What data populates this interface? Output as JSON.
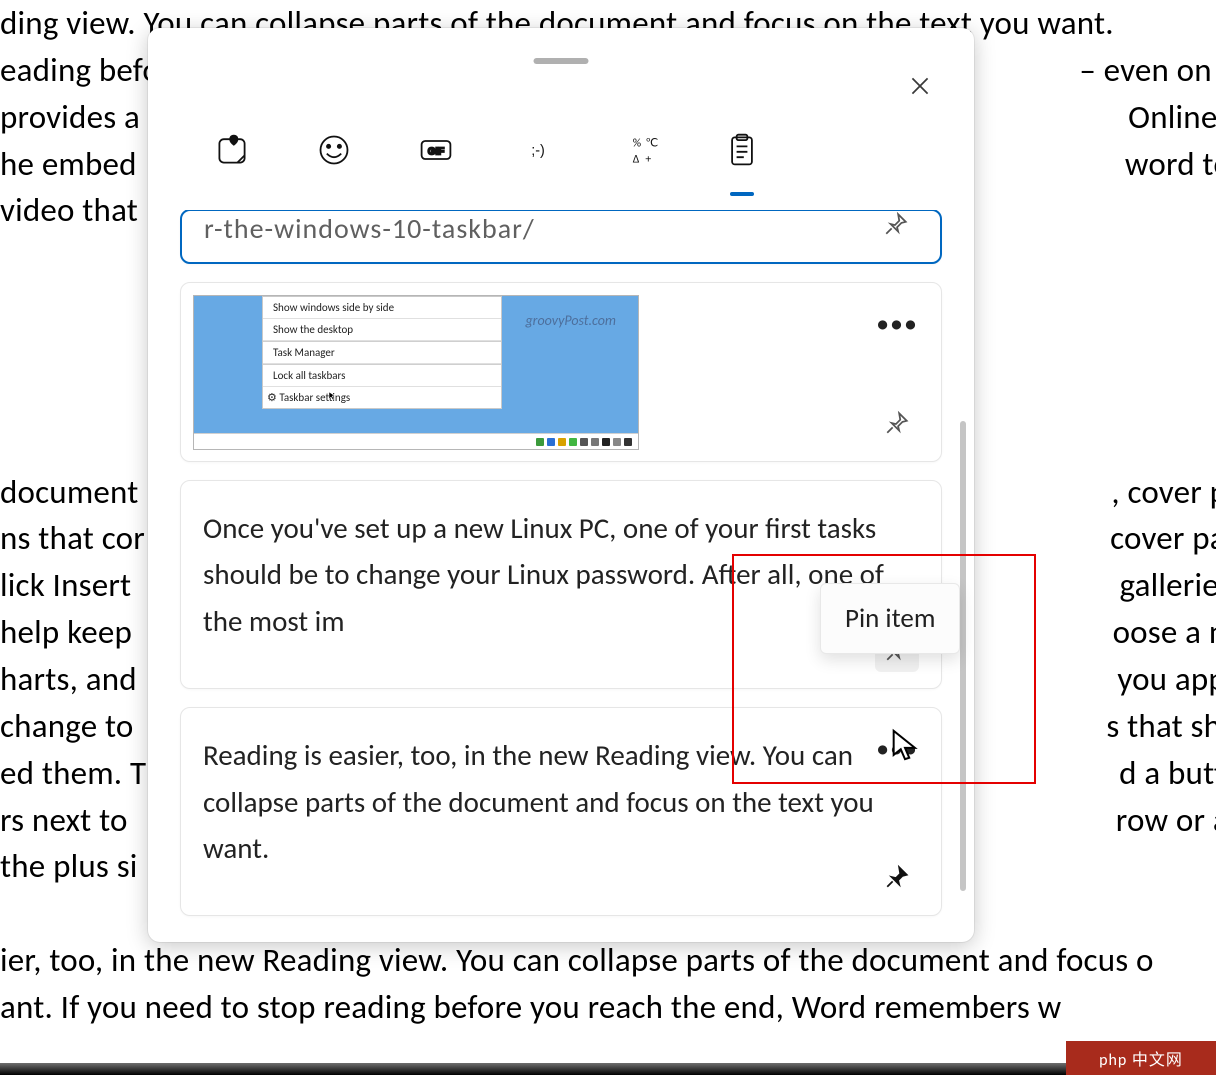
{
  "background_doc_text": "ding view. You can collapse parts of the document and focus on the text you want.\neading before you reach                                                                                                  – even on anot\nprovides a                                                                                                                                 Online Video,\nhe embed                                                                                                                                 word to search\nvideo that\n\n\n\n\n\ndocument                                                                                                                               , cover page, a\nns that cor                                                                                                                              cover page, he\nlick Insert                                                                                                                                 galleries. Them\nhelp keep                                                                                                                                oose a new Th\nharts, and                                                                                                                                you apply styl\nchange to                                                                                                                               s that show up\ned them. T                                                                                                                               d a button for l\nrs next to                                                                                                                                 row or a colum\nthe plus si\n\nier, too, in the new Reading view. You can collapse parts of the document and focus o\nant. If you need to stop reading before you reach the end, Word remembers w",
  "clipboard": {
    "tooltip": "Pin item",
    "item1_text": "r-the-windows-10-taskbar/",
    "item2_thumbnail": {
      "watermark": "groovyPost.com",
      "menu_items": [
        "Show windows side by side",
        "Show the desktop",
        "Task Manager",
        "Lock all taskbars",
        "Taskbar settings"
      ]
    },
    "item3_text": "Once you've set up a new Linux PC, one of your first tasks should be to change your Linux password. After all, one of the most im",
    "item4_text": "Reading is easier, too, in the new Reading view. You can collapse parts of the document and focus on the text you want."
  },
  "watermark_label": "php 中文网"
}
